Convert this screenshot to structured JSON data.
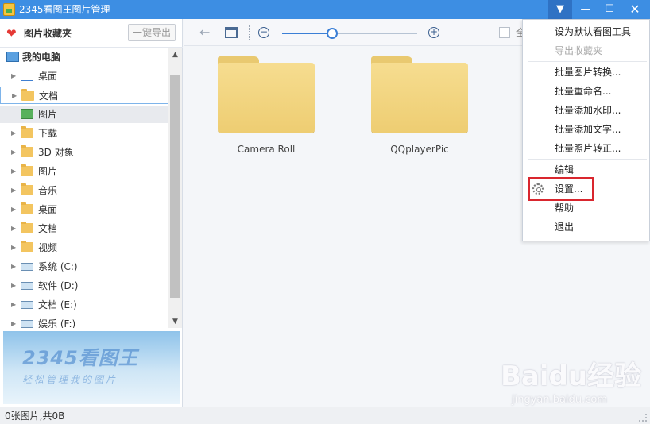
{
  "window": {
    "title": "2345看图王图片管理",
    "dropdown_glyph": "▼",
    "minimize_glyph": "—",
    "maximize_glyph": "☐",
    "close_glyph": "✕"
  },
  "favorites": {
    "label": "图片收藏夹",
    "export_label": "一键导出",
    "heart_glyph": "❤"
  },
  "tree": {
    "items": [
      {
        "label": "我的电脑",
        "icon": "computer-icon"
      },
      {
        "label": "桌面",
        "icon": "desktop-icon"
      },
      {
        "label": "文档",
        "icon": "documents-icon"
      },
      {
        "label": "图片",
        "icon": "pictures-icon"
      },
      {
        "label": "下载",
        "icon": "folder-icon"
      },
      {
        "label": "3D 对象",
        "icon": "folder-icon"
      },
      {
        "label": "图片",
        "icon": "folder-icon"
      },
      {
        "label": "音乐",
        "icon": "folder-icon"
      },
      {
        "label": "桌面",
        "icon": "folder-icon"
      },
      {
        "label": "文档",
        "icon": "folder-icon"
      },
      {
        "label": "视频",
        "icon": "folder-icon"
      },
      {
        "label": "系统 (C:)",
        "icon": "drive-icon"
      },
      {
        "label": "软件 (D:)",
        "icon": "drive-icon"
      },
      {
        "label": "文档 (E:)",
        "icon": "drive-icon"
      },
      {
        "label": "娱乐 (F:)",
        "icon": "drive-icon"
      }
    ]
  },
  "banner": {
    "logo": "2345看图王",
    "tagline": "轻松管理我的图片"
  },
  "toolbar": {
    "back_glyph": "←",
    "zoom_out_glyph": "−",
    "zoom_in_glyph": "+",
    "zoom_level": 0.37,
    "select_all_label": "全"
  },
  "folders": [
    {
      "name": "Camera Roll"
    },
    {
      "name": "QQplayerPic"
    }
  ],
  "menu": {
    "items": [
      {
        "label": "设为默认看图工具",
        "disabled": false
      },
      {
        "label": "导出收藏夹",
        "disabled": true
      },
      {
        "label": "批量图片转换...",
        "disabled": false
      },
      {
        "label": "批量重命名...",
        "disabled": false
      },
      {
        "label": "批量添加水印...",
        "disabled": false
      },
      {
        "label": "批量添加文字...",
        "disabled": false
      },
      {
        "label": "批量照片转正...",
        "disabled": false
      },
      {
        "label": "编辑",
        "disabled": false
      },
      {
        "label": "设置...",
        "disabled": false
      },
      {
        "label": "帮助",
        "disabled": false
      },
      {
        "label": "退出",
        "disabled": false
      }
    ]
  },
  "status": {
    "text": "0张图片,共0B"
  },
  "watermark": {
    "main": "Baidu经验",
    "sub": "jingyan.baidu.com"
  }
}
